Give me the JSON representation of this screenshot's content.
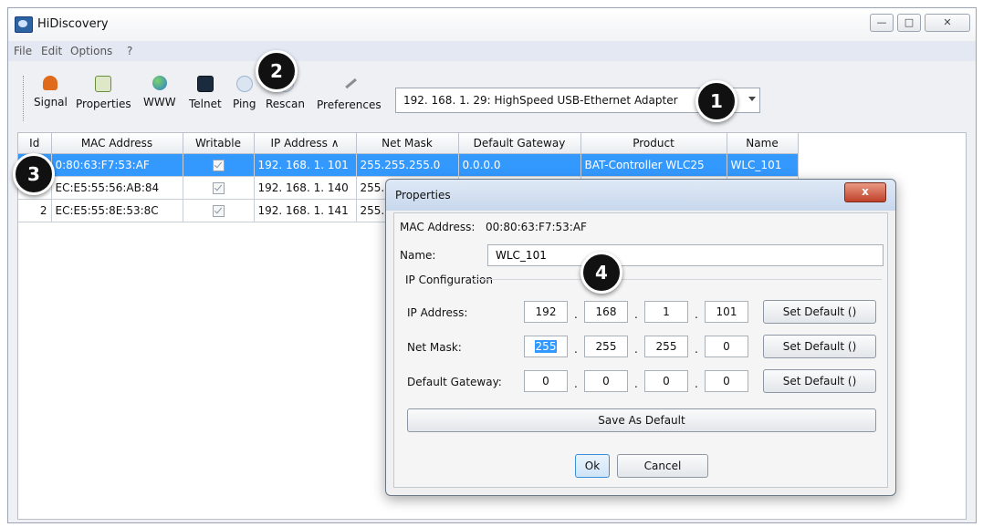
{
  "window": {
    "title": "HiDiscovery"
  },
  "menu": [
    "File",
    "Edit",
    "Options",
    "?"
  ],
  "toolbar": {
    "tools": [
      {
        "label": "Signal",
        "icon": "signal-icon",
        "color": "#e06a1c"
      },
      {
        "label": "Properties",
        "icon": "properties-icon",
        "color": "#6a8f3a"
      },
      {
        "label": "WWW",
        "icon": "globe-icon",
        "color": "#2a7bd1"
      },
      {
        "label": "Telnet",
        "icon": "terminal-icon",
        "color": "#1b2b3e"
      },
      {
        "label": "Ping",
        "icon": "ping-icon",
        "color": "#9fb4cf"
      },
      {
        "label": "Rescan",
        "icon": "rescan-icon",
        "color": "#b7c6d8"
      },
      {
        "label": "Preferences",
        "icon": "wrench-icon",
        "color": "#8c8c8c"
      }
    ],
    "adapter": "192. 168. 1. 29: HighSpeed USB-Ethernet Adapter"
  },
  "table": {
    "columns": [
      "Id",
      "MAC Address",
      "Writable",
      "IP Address ∧",
      "Net Mask",
      "Default Gateway",
      "Product",
      "Name"
    ],
    "rows": [
      {
        "id": "",
        "mac": "0:80:63:F7:53:AF",
        "ip": "192. 168. 1. 101",
        "mask": "255.255.255.0",
        "gw": "0.0.0.0",
        "product": "BAT-Controller WLC25",
        "name": "WLC_101"
      },
      {
        "id": "",
        "mac": "EC:E5:55:56:AB:84",
        "ip": "192. 168. 1. 140",
        "mask": "255.",
        "gw": "",
        "product": "",
        "name": ""
      },
      {
        "id": "2",
        "mac": "EC:E5:55:8E:53:8C",
        "ip": "192. 168. 1. 141",
        "mask": "255.",
        "gw": "",
        "product": "",
        "name": ""
      }
    ]
  },
  "dialog": {
    "title": "Properties",
    "close": "x",
    "mac_label": "MAC Address:",
    "mac_value": "00:80:63:F7:53:AF",
    "name_label": "Name:",
    "name_value": "WLC_101",
    "group_title": "IP Configuration",
    "ip_label": "IP Address:",
    "ip_octets": [
      "192",
      "168",
      "1",
      "101"
    ],
    "mask_label": "Net Mask:",
    "mask_octets": [
      "255",
      "255",
      "255",
      "0"
    ],
    "gw_label": "Default Gateway:",
    "gw_octets": [
      "0",
      "0",
      "0",
      "0"
    ],
    "dot": ".",
    "set_default": "Set Default ()",
    "save_default": "Save As Default",
    "ok": "Ok",
    "cancel": "Cancel"
  },
  "callouts": [
    "1",
    "2",
    "3",
    "4"
  ]
}
